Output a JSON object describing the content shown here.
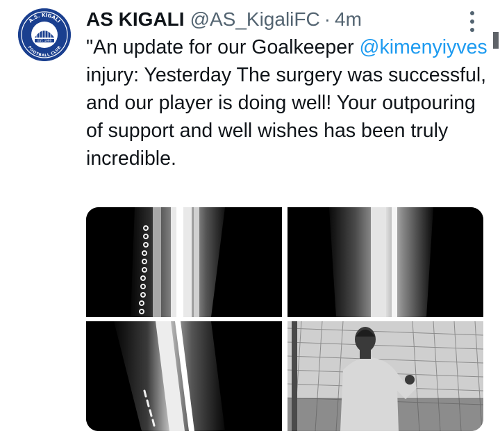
{
  "account": {
    "display_name": "AS KIGALI",
    "handle": "@AS_KigaliFC",
    "separator": "·",
    "time": "4m",
    "avatar_icon": "club-crest-icon",
    "avatar_arc_top": "A.S. KIGALI",
    "avatar_arc_bottom": "FOOTBALL CLUB",
    "avatar_est": "EST. 1999"
  },
  "tweet": {
    "text_before": "\"An update for our Goalkeeper ",
    "mention": "@kimenyiyves",
    "text_after": " injury: Yesterday The surgery was successful, and our player is doing well! Your outpouring of support and well wishes has been truly incredible."
  },
  "media": {
    "items": [
      {
        "icon": "xray-image-1"
      },
      {
        "icon": "xray-image-2"
      },
      {
        "icon": "xray-image-3"
      },
      {
        "icon": "goalkeeper-photo"
      }
    ]
  },
  "colors": {
    "accent": "#1d9bf0",
    "secondary_text": "#536471",
    "avatar_blue": "#1a3f8f"
  }
}
